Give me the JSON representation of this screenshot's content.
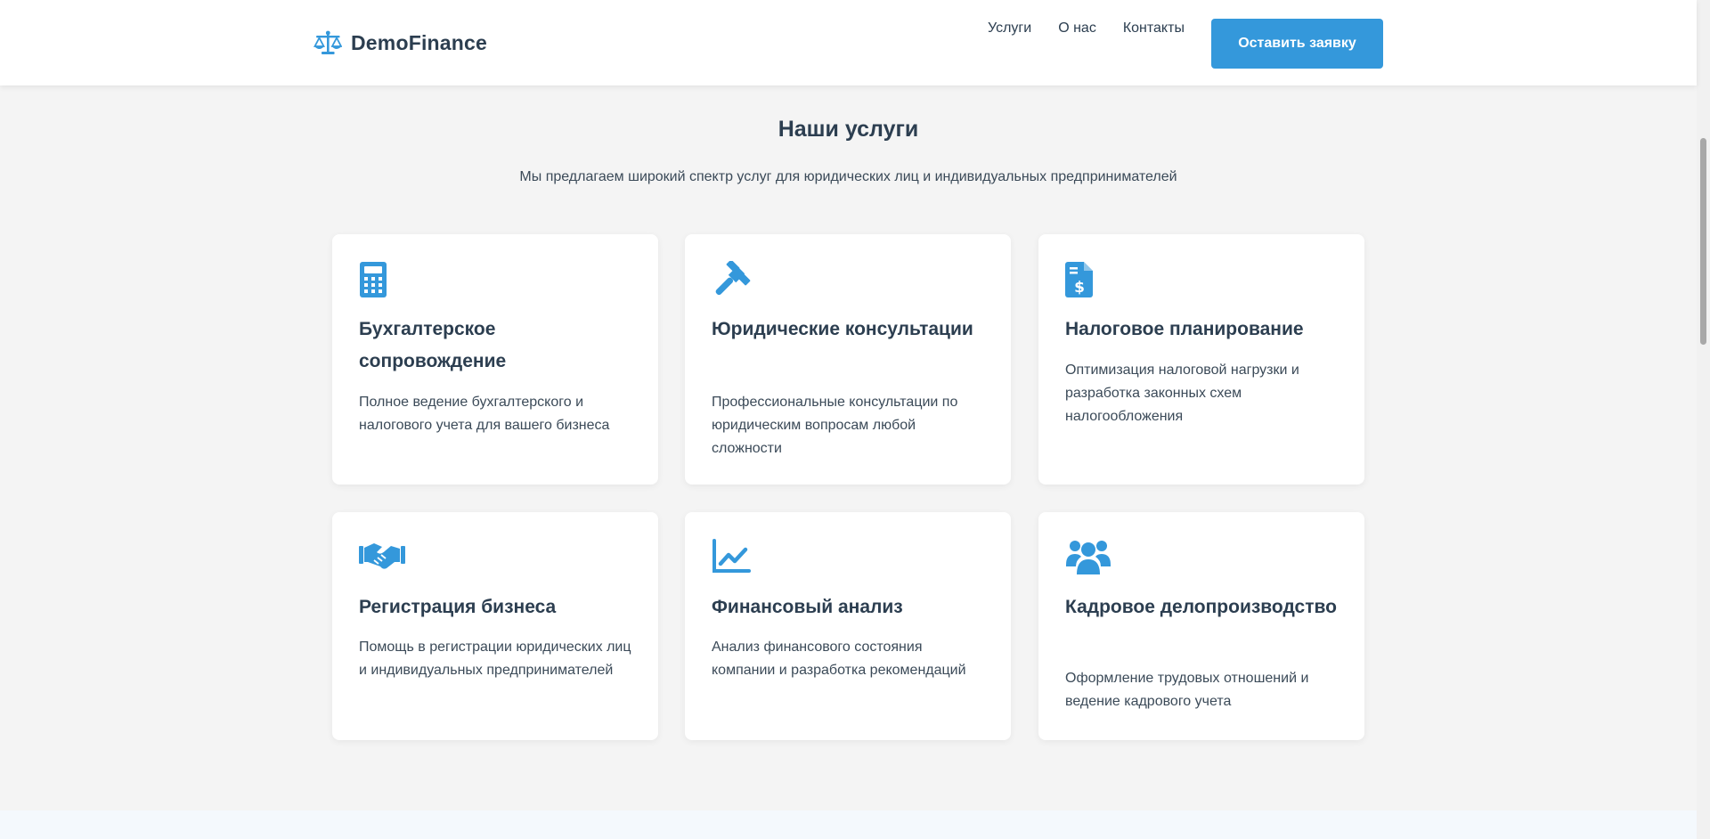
{
  "brand": {
    "name": "DemoFinance",
    "icon": "scales-icon",
    "accent_color": "#3498db"
  },
  "nav": {
    "items": [
      {
        "label": "Услуги"
      },
      {
        "label": "О нас"
      },
      {
        "label": "Контакты"
      }
    ],
    "cta_label": "Оставить заявку"
  },
  "services": {
    "title": "Наши услуги",
    "subtitle": "Мы предлагаем широкий спектр услуг для юридических лиц и индивидуальных предпринимателей",
    "cards": [
      {
        "icon": "calculator-icon",
        "title": "Бухгалтерское сопровождение",
        "text": "Полное ведение бухгалтерского и налогового учета для вашего бизнеса"
      },
      {
        "icon": "gavel-icon",
        "title": "Юридические консультации",
        "text": "Профессиональные консультации по юридическим вопросам любой сложности"
      },
      {
        "icon": "invoice-dollar-icon",
        "title": "Налоговое планирование",
        "text": "Оптимизация налоговой нагрузки и разработка законных схем налогообложения"
      },
      {
        "icon": "handshake-icon",
        "title": "Регистрация бизнеса",
        "text": "Помощь в регистрации юридических лиц и индивидуальных предпринимателей"
      },
      {
        "icon": "chart-line-icon",
        "title": "Финансовый анализ",
        "text": "Анализ финансового состояния компании и разработка рекомендаций"
      },
      {
        "icon": "users-icon",
        "title": "Кадровое делопроизводство",
        "text": "Оформление трудовых отношений и ведение кадрового учета"
      }
    ]
  }
}
